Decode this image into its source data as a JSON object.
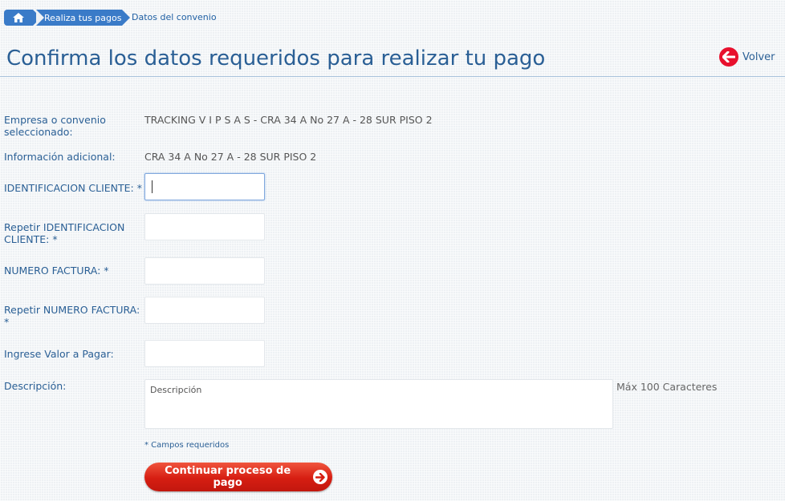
{
  "breadcrumb": {
    "home_icon": "home-icon",
    "step1": "Realiza tus pagos",
    "current": "Datos del convenio"
  },
  "header": {
    "title": "Confirma los datos requeridos para realizar tu pago",
    "back_label": "Volver",
    "back_icon": "arrow-left-circle-icon"
  },
  "form": {
    "empresa_label": "Empresa o convenio seleccionado:",
    "empresa_value": "TRACKING V I P S A S - CRA 34 A No 27 A - 28 SUR PISO 2",
    "info_label": "Información adicional:",
    "info_value": "CRA 34 A No 27 A - 28 SUR PISO 2",
    "id_label": "IDENTIFICACION CLIENTE: *",
    "id_value": "",
    "id_repeat_label": "Repetir IDENTIFICACION CLIENTE: *",
    "id_repeat_value": "",
    "factura_label": "NUMERO FACTURA: *",
    "factura_value": "",
    "factura_repeat_label": "Repetir NUMERO FACTURA: *",
    "factura_repeat_value": "",
    "valor_label": "Ingrese Valor a Pagar:",
    "valor_value": "",
    "descripcion_label": "Descripción:",
    "descripcion_placeholder": "Descripción",
    "descripcion_max": "Máx 100 Caracteres",
    "required_note": "* Campos requeridos",
    "submit_label": "Continuar proceso de pago",
    "submit_icon": "arrow-right-circle-icon"
  },
  "colors": {
    "accent_blue": "#3a7bc8",
    "title_blue": "#2a5f95",
    "button_red": "#d61e12",
    "back_red": "#e8102d"
  }
}
